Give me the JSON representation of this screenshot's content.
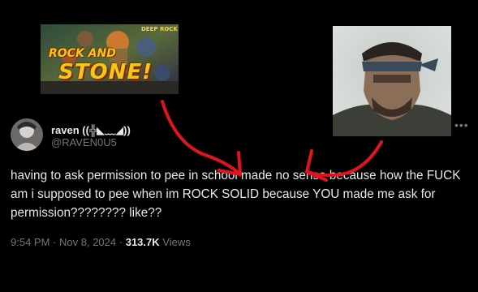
{
  "overlay": {
    "left_image_text_line1": "ROCK AND",
    "left_image_text_line2": "STONE!",
    "left_image_corner": "DEEP ROCK"
  },
  "tweet": {
    "display_name": "raven ((╬◣﹏◢))",
    "handle": "@RAVEN0U5",
    "text": "having to ask permission to pee in school made no sense because how the FUCK am i supposed to pee when im ROCK SOLID because YOU made me ask for permission???????? like??",
    "time": "9:54 PM",
    "date": "Nov 8, 2024",
    "views_count": "313.7K",
    "views_label": "Views",
    "separator": "·"
  },
  "colors": {
    "background": "#000000",
    "text_primary": "#e7e9ea",
    "text_secondary": "#71767b",
    "arrow": "#e0141c"
  },
  "icons": [
    "more-icon",
    "avatar"
  ]
}
